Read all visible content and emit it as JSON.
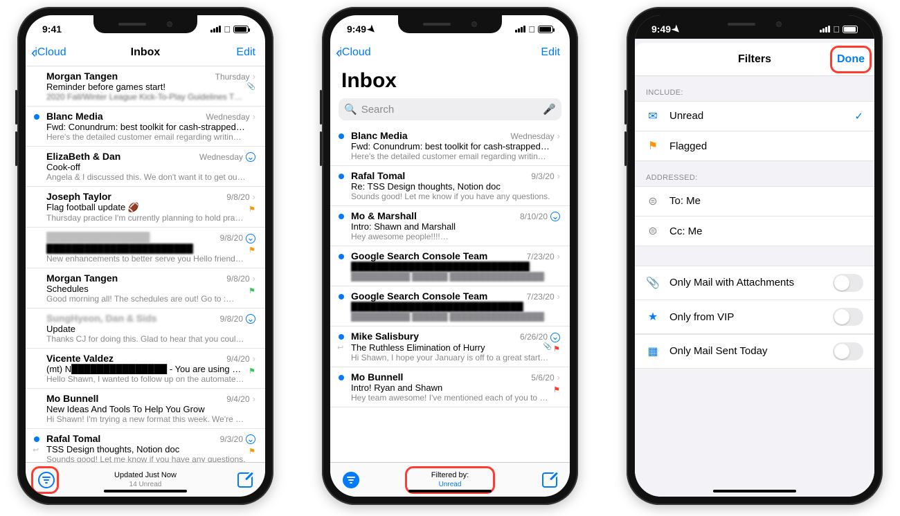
{
  "status": {
    "time1": "9:41",
    "time2": "9:49",
    "time3": "9:49"
  },
  "nav": {
    "back": "iCloud",
    "title": "Inbox",
    "edit": "Edit",
    "filters_title": "Filters",
    "done": "Done"
  },
  "search": {
    "placeholder": "Search"
  },
  "toolbar1": {
    "line1": "Updated Just Now",
    "line2": "14 Unread"
  },
  "toolbar2": {
    "line1": "Filtered by:",
    "line2": "Unread"
  },
  "phone1_rows": [
    {
      "sender": "Morgan Tangen",
      "date": "Thursday",
      "subject": "Reminder before games start!",
      "preview": "2020 Fall/Winter League Kick-To-Play Guidelines The f…",
      "unread": false,
      "chev": true,
      "attach": true,
      "redactPrev": true
    },
    {
      "sender": "Blanc Media",
      "date": "Wednesday",
      "subject": "Fwd: Conundrum: best toolkit for cash-strapped people",
      "preview": "Here's the detailed customer email regarding writing tool…",
      "unread": true,
      "chev": true
    },
    {
      "sender": "ElizaBeth & Dan",
      "date": "Wednesday",
      "subject": "Cook-off",
      "preview": "Angela & I discussed this. We don't want it to get out of…",
      "unread": false,
      "thread": true
    },
    {
      "sender": "Joseph Taylor",
      "date": "9/8/20",
      "subject": "Flag football update 🏈",
      "preview": "Thursday practice I'm currently planning to hold practice…",
      "unread": false,
      "chev": true,
      "flag": "orange"
    },
    {
      "sender": "███████████████",
      "date": "9/8/20",
      "subject": "███████████████████████",
      "preview": "New enhancements to better serve you Hello friend, CH…",
      "unread": false,
      "thread": true,
      "flag": "orange",
      "redactSender": true,
      "redactSubj": true
    },
    {
      "sender": "Morgan Tangen",
      "date": "9/8/20",
      "subject": "Schedules",
      "preview": "Good morning all! The schedules are out! Go to :…",
      "unread": false,
      "chev": true,
      "flag": "green"
    },
    {
      "sender": "SungHyeon, Dan & Sids",
      "date": "9/8/20",
      "subject": "Update",
      "preview": "Thanks CJ for doing this. Glad to hear that you could talk…",
      "unread": false,
      "thread": true,
      "redactSender": true
    },
    {
      "sender": "Vicente Valdez",
      "date": "9/4/20",
      "subject": "(mt) N███████████████ - You are using a…",
      "preview": "Hello Shawn, I wanted to follow up on the automated noti…",
      "unread": false,
      "chev": true,
      "flag": "green"
    },
    {
      "sender": "Mo Bunnell",
      "date": "9/4/20",
      "subject": "New Ideas And Tools To Help You Grow",
      "preview": "Hi Shawn! I'm trying a new format this week. We're crank…",
      "unread": false,
      "chev": true
    },
    {
      "sender": "Rafal Tomal",
      "date": "9/3/20",
      "subject": "TSS Design thoughts, Notion doc",
      "preview": "Sounds good! Let me know if you have any questions.",
      "unread": true,
      "thread": true,
      "flag": "orange",
      "reply": true
    }
  ],
  "phone2_rows": [
    {
      "sender": "Blanc Media",
      "date": "Wednesday",
      "subject": "Fwd: Conundrum: best toolkit for cash-strapped people",
      "preview": "Here's the detailed customer email regarding writing tool…",
      "unread": true,
      "chev": true
    },
    {
      "sender": "Rafal Tomal",
      "date": "9/3/20",
      "subject": "Re: TSS Design thoughts, Notion doc",
      "preview": "Sounds good! Let me know if you have any questions.",
      "unread": true,
      "chev": true
    },
    {
      "sender": "Mo & Marshall",
      "date": "8/10/20",
      "subject": "Intro: Shawn and Marshall",
      "preview": "Hey awesome people!!!!…",
      "unread": true,
      "thread": true
    },
    {
      "sender": "Google Search Console Team",
      "date": "7/23/20",
      "subject": "████████████████████████████",
      "preview": "██████████ ██████ ████████████████",
      "unread": true,
      "chev": true,
      "redactSubj": true,
      "redactPrev": true
    },
    {
      "sender": "Google Search Console Team",
      "date": "7/23/20",
      "subject": "███████████████████████████",
      "preview": "██████████ ██████ ████████████████",
      "unread": true,
      "chev": true,
      "redactSubj": true,
      "redactPrev": true
    },
    {
      "sender": "Mike Salisbury",
      "date": "6/26/20",
      "subject": "The Ruthless Elimination of Hurry",
      "preview": "Hi Shawn, I hope your January is off to a great start. I've…",
      "unread": true,
      "thread": true,
      "reply": true,
      "attach": true,
      "flag": "red"
    },
    {
      "sender": "Mo Bunnell",
      "date": "5/6/20",
      "subject": "Intro! Ryan and Shawn",
      "preview": "Hey team awesome! I've mentioned each of you to each…",
      "unread": true,
      "chev": true,
      "flag": "red"
    }
  ],
  "filters": {
    "include_header": "INCLUDE:",
    "addressed_header": "ADDRESSED:",
    "unread": "Unread",
    "flagged": "Flagged",
    "to_me": "To: Me",
    "cc_me": "Cc: Me",
    "attachments": "Only Mail with Attachments",
    "vip": "Only from VIP",
    "today": "Only Mail Sent Today"
  }
}
